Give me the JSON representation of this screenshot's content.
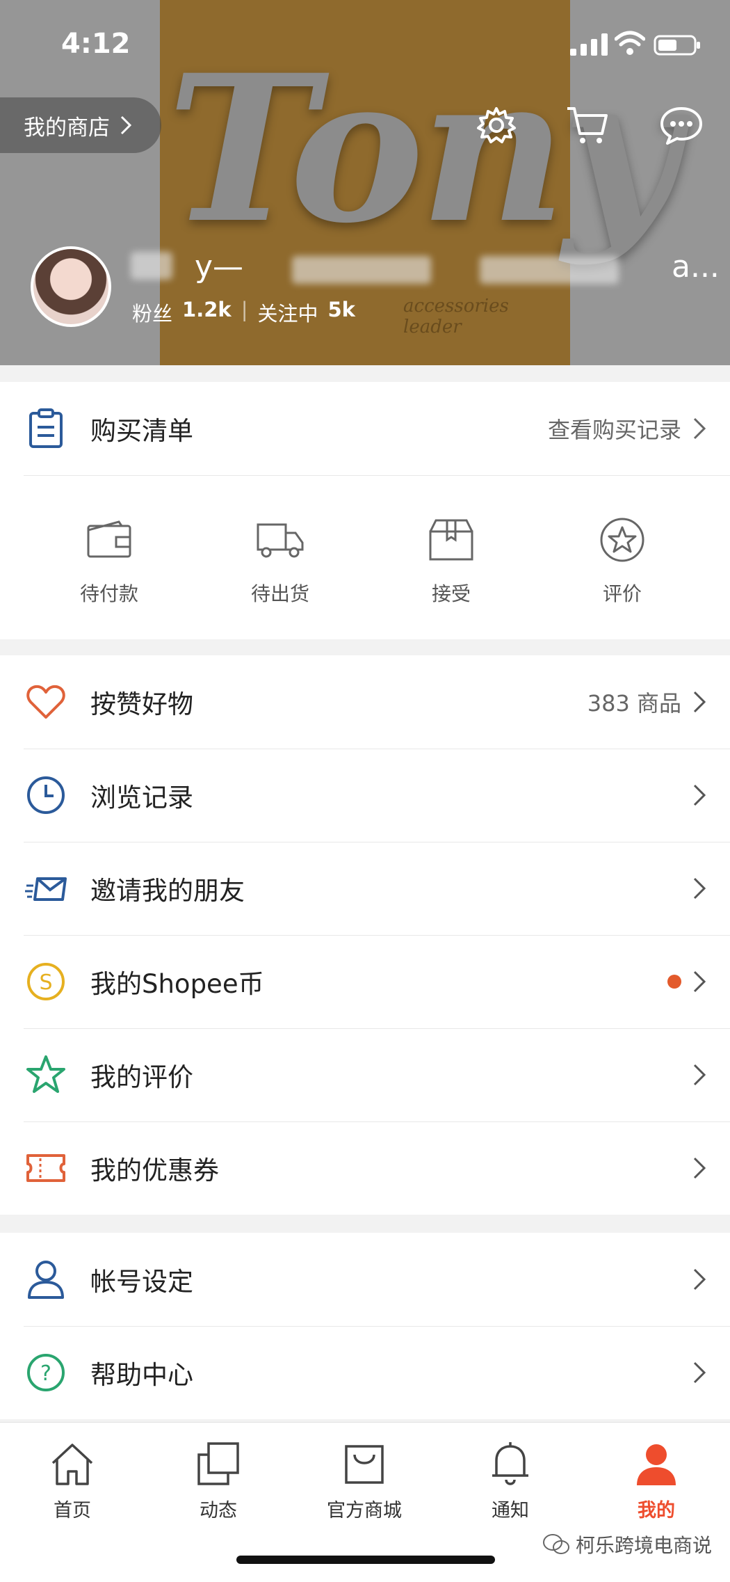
{
  "status_bar": {
    "time": "4:12"
  },
  "header": {
    "shop_button_label": "我的商店",
    "cover_word": "Tony",
    "cover_tagline": "accessories leader",
    "username_visible": "y—",
    "username_tail": "a...",
    "followers_label": "粉丝",
    "followers_count": "1.2k",
    "following_label": "关注中",
    "following_count": "5k"
  },
  "purchases": {
    "title": "购买清单",
    "history_link": "查看购买记录",
    "orders": [
      {
        "label": "待付款",
        "icon": "wallet-icon"
      },
      {
        "label": "待出货",
        "icon": "truck-icon"
      },
      {
        "label": "接受",
        "icon": "box-icon"
      },
      {
        "label": "评价",
        "icon": "star-circle-icon"
      }
    ]
  },
  "menu_group_1": [
    {
      "label": "按赞好物",
      "right_text": "383 商品",
      "icon": "heart-icon",
      "color": "#e0623a"
    },
    {
      "label": "浏览记录",
      "right_text": "",
      "icon": "clock-icon",
      "color": "#2b5a9a"
    },
    {
      "label": "邀请我的朋友",
      "right_text": "",
      "icon": "mail-icon",
      "color": "#2b5a9a"
    },
    {
      "label": "我的Shopee币",
      "right_text": "",
      "icon": "coin-icon",
      "color": "#e6b020",
      "has_dot": true
    },
    {
      "label": "我的评价",
      "right_text": "",
      "icon": "star-icon",
      "color": "#2aa56f"
    },
    {
      "label": "我的优惠券",
      "right_text": "",
      "icon": "ticket-icon",
      "color": "#e0623a"
    }
  ],
  "menu_group_2": [
    {
      "label": "帐号设定",
      "icon": "user-icon",
      "color": "#2b5a9a"
    },
    {
      "label": "帮助中心",
      "icon": "help-icon",
      "color": "#2aa56f"
    }
  ],
  "bottom_nav": {
    "tabs": [
      {
        "label": "首页",
        "icon": "home-icon",
        "active": false
      },
      {
        "label": "动态",
        "icon": "feed-icon",
        "active": false
      },
      {
        "label": "官方商城",
        "icon": "mall-bag-icon",
        "active": false
      },
      {
        "label": "通知",
        "icon": "bell-icon",
        "active": false
      },
      {
        "label": "我的",
        "icon": "profile-icon",
        "active": true
      }
    ],
    "active_color": "#ee4d2d"
  },
  "watermark": "柯乐跨境电商说"
}
